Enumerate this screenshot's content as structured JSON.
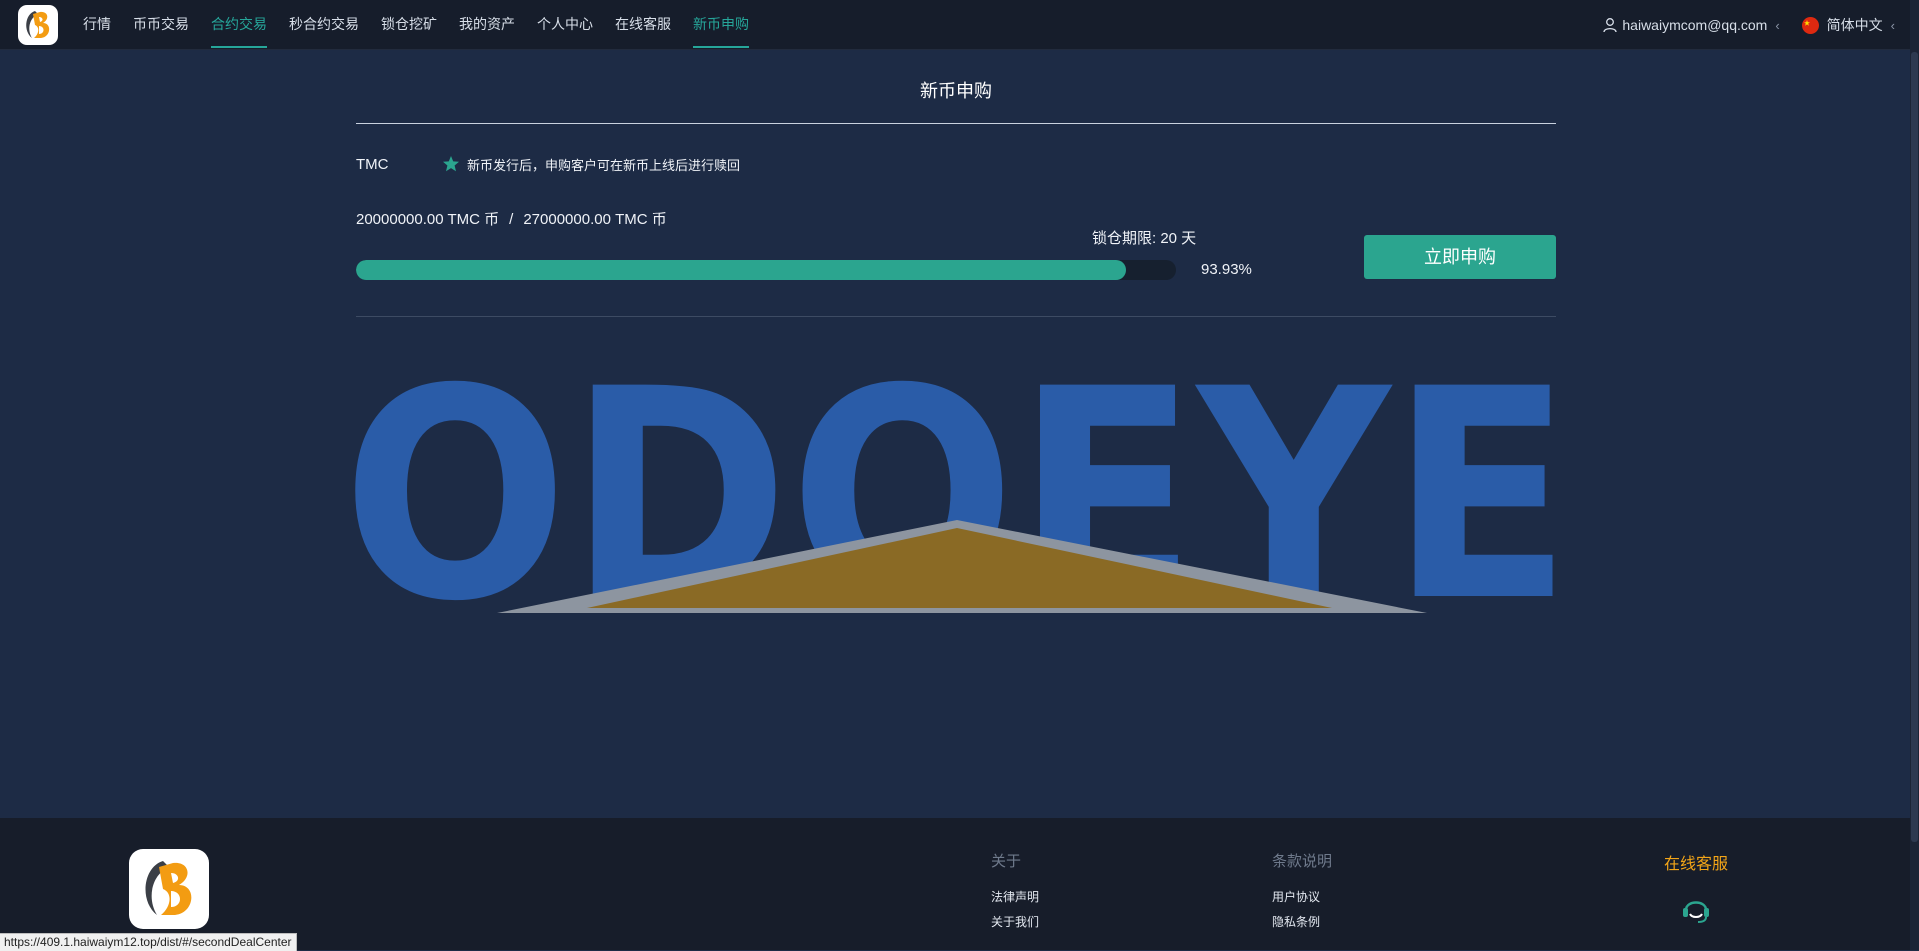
{
  "nav": {
    "menu": [
      {
        "label": "行情",
        "active": false
      },
      {
        "label": "币币交易",
        "active": false
      },
      {
        "label": "合约交易",
        "active": true
      },
      {
        "label": "秒合约交易",
        "active": false
      },
      {
        "label": "锁仓挖矿",
        "active": false
      },
      {
        "label": "我的资产",
        "active": false
      },
      {
        "label": "个人中心",
        "active": false
      },
      {
        "label": "在线客服",
        "active": false
      },
      {
        "label": "新币申购",
        "active": true
      }
    ],
    "user_email": "haiwaiymcom@qq.com",
    "language": "简体中文"
  },
  "page": {
    "title": "新币申购",
    "coin": "TMC",
    "notice": "新币发行后，申购客户可在新币上线后进行赎回",
    "sold_amount": "20000000.00 TMC 币",
    "amount_separator": "/",
    "total_amount": "27000000.00 TMC 币",
    "lock_period": "锁仓期限: 20 天",
    "progress_percent": 93.93,
    "progress_label": "93.93%",
    "apply_button": "立即申购",
    "banner_text": "ODOEYE"
  },
  "footer": {
    "about_title": "关于",
    "about_links": [
      "法律声明",
      "关于我们"
    ],
    "terms_title": "条款说明",
    "terms_links": [
      "用户协议",
      "隐私条例"
    ],
    "support_title": "在线客服"
  },
  "status_bar_url": "https://409.1.haiwaiym12.top/dist/#/secondDealCenter",
  "colors": {
    "accent": "#2ba58f",
    "background": "#1d2b45",
    "nav_bg": "#161d2b",
    "support_title": "#f3a518"
  }
}
